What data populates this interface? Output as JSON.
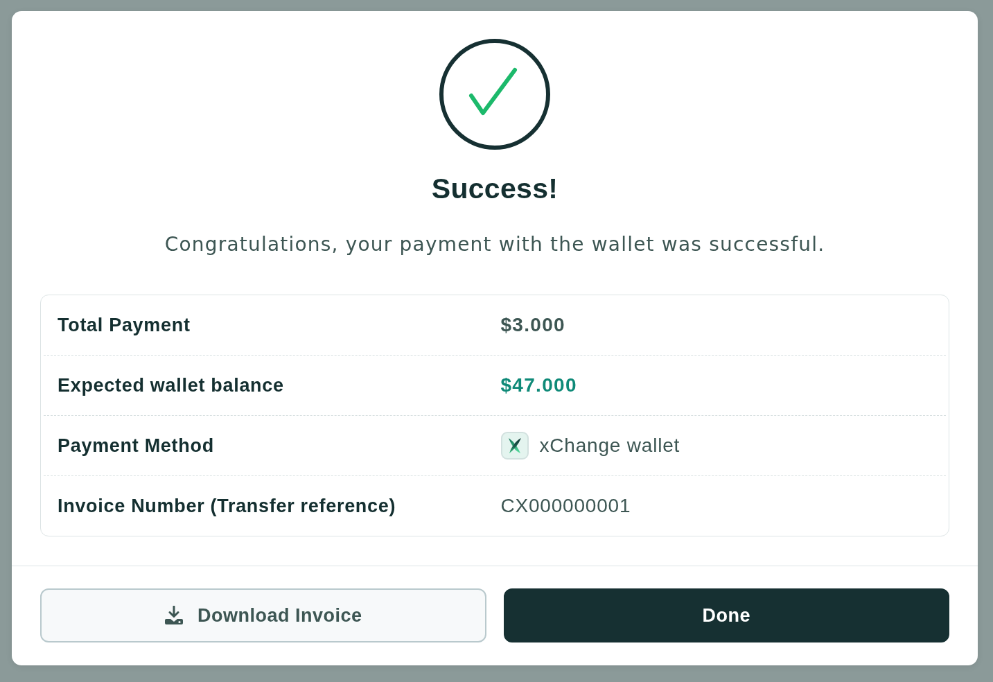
{
  "dialog": {
    "title": "Success!",
    "message": "Congratulations, your payment with the wallet was successful."
  },
  "details": [
    {
      "kind": "amount",
      "label": "Total Payment",
      "value": "$3.000"
    },
    {
      "kind": "balance",
      "label": "Expected wallet balance",
      "value": "$47.000"
    },
    {
      "kind": "method",
      "label": "Payment Method",
      "value": "xChange wallet"
    },
    {
      "kind": "reference",
      "label": "Invoice Number (Transfer reference)",
      "value": "CX000000001"
    }
  ],
  "buttons": [
    {
      "kind": "secondary",
      "label": "Download Invoice"
    },
    {
      "kind": "primary",
      "label": "Done"
    }
  ]
}
